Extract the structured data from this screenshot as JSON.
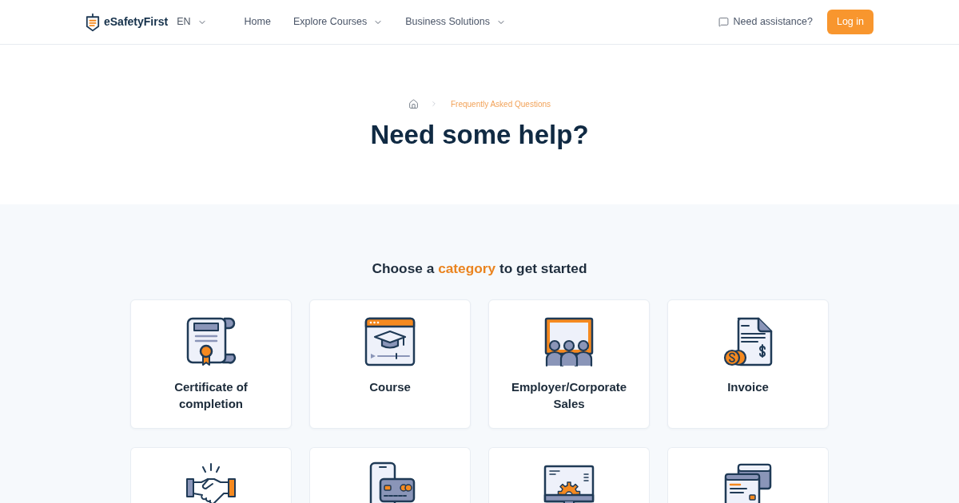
{
  "header": {
    "logo": {
      "text": "eSafetyFirst"
    },
    "language": {
      "label": "EN"
    },
    "nav": [
      {
        "label": "Home",
        "has_dropdown": false
      },
      {
        "label": "Explore Courses",
        "has_dropdown": true
      },
      {
        "label": "Business Solutions",
        "has_dropdown": true
      }
    ],
    "help_link": {
      "label": "Need assistance?"
    },
    "login_button": {
      "label": "Log in"
    }
  },
  "hero": {
    "breadcrumb": [
      {
        "kind": "home"
      },
      {
        "kind": "page",
        "label": "Frequently Asked Questions"
      }
    ],
    "title": "Need some help?"
  },
  "categories_section": {
    "heading": {
      "before": "Choose a",
      "highlight": "category",
      "after": "to get started"
    },
    "categories": [
      {
        "kind": "certificate",
        "label": "Certificate of completion"
      },
      {
        "kind": "course",
        "label": "Course"
      },
      {
        "kind": "employer",
        "label": "Employer/Corporate Sales"
      },
      {
        "kind": "invoice",
        "label": "Invoice"
      },
      {
        "kind": "partnership"
      },
      {
        "kind": "payment"
      },
      {
        "kind": "settings"
      },
      {
        "kind": "documents"
      }
    ]
  }
}
